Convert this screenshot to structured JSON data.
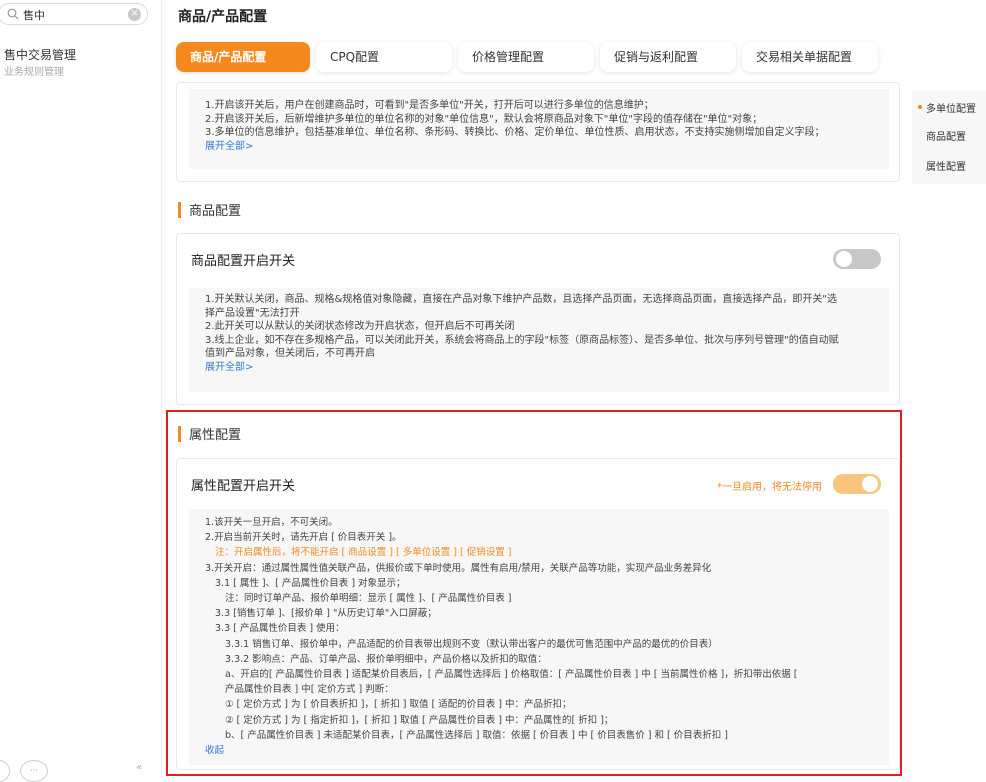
{
  "sidebar": {
    "search_value": "售中",
    "nav_title": "售中交易管理",
    "nav_subtitle": "业务规则管理",
    "bottom_badge": "···",
    "collapse_glyph": "«"
  },
  "page_title": "商品/产品配置",
  "tabs": [
    {
      "label": "商品/产品配置",
      "active": true
    },
    {
      "label": "CPQ配置",
      "active": false
    },
    {
      "label": "价格管理配置",
      "active": false
    },
    {
      "label": "促销与返利配置",
      "active": false
    },
    {
      "label": "交易相关单据配置",
      "active": false
    }
  ],
  "anchor_nav": [
    "多单位配置",
    "商品配置",
    "属性配置"
  ],
  "multi_unit": {
    "lines": [
      "1.开启该开关后，用户在创建商品时，可看到\"是否多单位\"开关，打开后可以进行多单位的信息维护；",
      "2.开启该开关后，后新增维护多单位的单位名称的对象\"单位信息\"，默认会将原商品对象下\"单位\"字段的值存储在\"单位\"对象；",
      "3.多单位的信息维护，包括基准单位、单位名称、条形码、转换比、价格、定价单位、单位性质、启用状态，不支持实施侧增加自定义字段；"
    ],
    "expand_label": "展开全部>"
  },
  "product_config": {
    "section_title": "商品配置",
    "card_title": "商品配置开启开关",
    "toggle_on": false,
    "lines": [
      "1.开关默认关闭，商品、规格&规格值对象隐藏，直接在产品对象下维护产品数，且选择产品页面，无选择商品页面，直接选择产品，即开关\"选",
      "择产品设置\"无法打开",
      "2.此开关可以从默认的关闭状态修改为开启状态，但开启后不可再关闭",
      "3.线上企业，如不存在多规格产品，可以关闭此开关，系统会将商品上的字段\"标签（原商品标签）、是否多单位、批次与序列号管理\"的值自动赋",
      "值到产品对象，但关闭后，不可再开启"
    ],
    "expand_label": "展开全部>"
  },
  "attribute_config": {
    "section_title": "属性配置",
    "card_title": "属性配置开启开关",
    "warning": "*一旦启用，将无法停用",
    "toggle_on": true,
    "lines": [
      {
        "text": "1.该开关一旦开启，不可关闭。",
        "indent": 0,
        "warn": false
      },
      {
        "text": "2.开启当前开关时，请先开启 [ 价目表开关 ]。",
        "indent": 0,
        "warn": false
      },
      {
        "text": "注：开启属性后，将不能开启 [ 商品设置 ] [ 多单位设置 ] [ 促销设置 ]",
        "indent": 1,
        "warn": true
      },
      {
        "text": "3.开关开启：通过属性属性值关联产品，供报价或下单时使用。属性有启用/禁用，关联产品等功能，实现产品业务差异化",
        "indent": 0,
        "warn": false
      },
      {
        "text": "3.1 [ 属性 ]、[ 产品属性价目表 ] 对象显示；",
        "indent": 1,
        "warn": false
      },
      {
        "text": "注：同时订单产品、报价单明细：显示 [ 属性 ]、[ 产品属性价目表 ]",
        "indent": 2,
        "warn": false
      },
      {
        "text": "3.3 [销售订单 ]、[报价单 ] \"从历史订单\"入口屏蔽；",
        "indent": 1,
        "warn": false
      },
      {
        "text": "3.3 [ 产品属性价目表 ] 使用：",
        "indent": 1,
        "warn": false
      },
      {
        "text": "3.3.1 销售订单、报价单中，产品适配的价目表带出规则不变（默认带出客户的最优可售范围中产品的最优的价目表）",
        "indent": 2,
        "warn": false
      },
      {
        "text": "3.3.2 影响点：产品、订单产品、报价单明细中，产品价格以及折扣的取值：",
        "indent": 2,
        "warn": false
      },
      {
        "text": "a、开启的[ 产品属性价目表 ] 适配某价目表后，[ 产品属性选择后 ] 价格取值：[ 产品属性价目表 ] 中 [ 当前属性价格 ]，折扣带出依据 [",
        "indent": 2,
        "warn": false
      },
      {
        "text": "产品属性价目表 ] 中[ 定价方式 ] 判断：",
        "indent": 2,
        "warn": false
      },
      {
        "text": "① [ 定价方式 ] 为 [ 价目表折扣 ]，[ 折扣 ] 取值 [ 适配的价目表 ] 中：产品折扣；",
        "indent": 2,
        "warn": false
      },
      {
        "text": "② [ 定价方式 ] 为 [ 指定折扣 ]，[ 折扣 ] 取值 [ 产品属性价目表 ] 中：产品属性的[ 折扣 ]；",
        "indent": 2,
        "warn": false
      },
      {
        "text": "b、[ 产品属性价目表 ] 未适配某价目表，[ 产品属性选择后 ] 取值：依据 [ 价目表 ] 中 [ 价目表售价 ] 和 [ 价目表折扣 ]",
        "indent": 2,
        "warn": false
      }
    ],
    "collapse_label": "收起"
  }
}
